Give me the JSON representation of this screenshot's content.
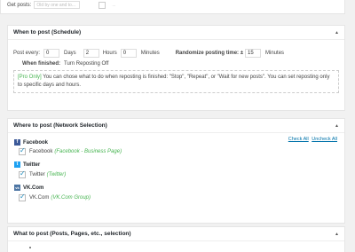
{
  "top": {
    "label": "Get posts:",
    "select_value": "Old by one   and to...",
    "faded": "..."
  },
  "schedule": {
    "title": "When to post (Schedule)",
    "post_every_label": "Post every:",
    "days_value": "0",
    "days_label": "Days",
    "hours_value": "2",
    "hours_label": "Hours",
    "minutes_value": "0",
    "minutes_label": "Minutes",
    "randomize_label": "Randomize posting time: ±",
    "randomize_value": "15",
    "randomize_minutes_label": "Minutes",
    "when_finished_label": "When finished:",
    "when_finished_value": "Turn Reposting Off",
    "pro_tag": "[Pro Only]",
    "pro_text": " You can chose what to do when reposting is finished: \"Stop\", \"Repeat\", or \"Wait for new posts\". You can set reposting only to specific days and hours."
  },
  "networks": {
    "title": "Where to post (Network Selection)",
    "check_all": "Check All",
    "uncheck_all": "Uncheck All",
    "items": [
      {
        "name": "Facebook",
        "account": "Facebook",
        "account_sub": "(Facebook - Business Page)",
        "color": "#3b5998",
        "glyph": "f"
      },
      {
        "name": "Twitter",
        "account": "Twitter",
        "account_sub": "(Twitter)",
        "color": "#1da1f2",
        "glyph": "t"
      },
      {
        "name": "VK.Com",
        "account": "VK.Com",
        "account_sub": "(VK.Com Group)",
        "color": "#4c75a3",
        "glyph": "vk"
      }
    ]
  },
  "what": {
    "title": "What to post (Posts, Pages, etc., selection)"
  },
  "toggle_glyph": "▲"
}
